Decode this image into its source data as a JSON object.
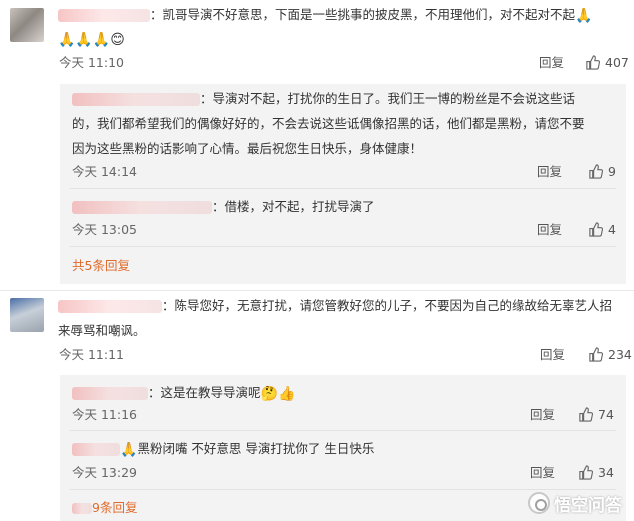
{
  "comment1": {
    "text": "：凯哥导演不好意思，下面是一些挑事的披皮黑，不用理他们，对不起对不起",
    "emojis": "🙏🙏🙏😊",
    "time": "今天 11:10",
    "reply_label": "回复",
    "likes": "407",
    "replies": [
      {
        "lines": [
          "：导演对不起，打扰你的生日了。我们王一博的粉丝是不会说这些话",
          "的，我们都希望我们的偶像好好的，不会去说这些诋偶像招黑的话，他们都是黑粉，请您不要",
          "因为这些黑粉的话影响了心情。最后祝您生日快乐，身体健康！"
        ],
        "time": "今天 14:14",
        "reply_label": "回复",
        "likes": "9"
      },
      {
        "lines": [
          "：借楼，对不起，打扰导演了"
        ],
        "time": "今天 13:05",
        "reply_label": "回复",
        "likes": "4"
      }
    ],
    "more_label": "共5条回复"
  },
  "comment2": {
    "lines": [
      "：陈导您好，无意打扰，请您管教好您的儿子，不要因为自己的缘故给无辜艺人招",
      "来辱骂和嘲讽。"
    ],
    "time": "今天 11:11",
    "reply_label": "回复",
    "likes": "234",
    "replies": [
      {
        "text": "：这是在教导导演呢",
        "emojis": "🤔👍",
        "time": "今天 11:16",
        "reply_label": "回复",
        "likes": "74"
      },
      {
        "text": "黑粉闭嘴   不好意思   导演打扰你了     生日快乐",
        "emojis": "🙏",
        "time": "今天 13:29",
        "reply_label": "回复",
        "likes": "34"
      }
    ],
    "more_label": "9条回复"
  },
  "watermark": "悟空问答"
}
